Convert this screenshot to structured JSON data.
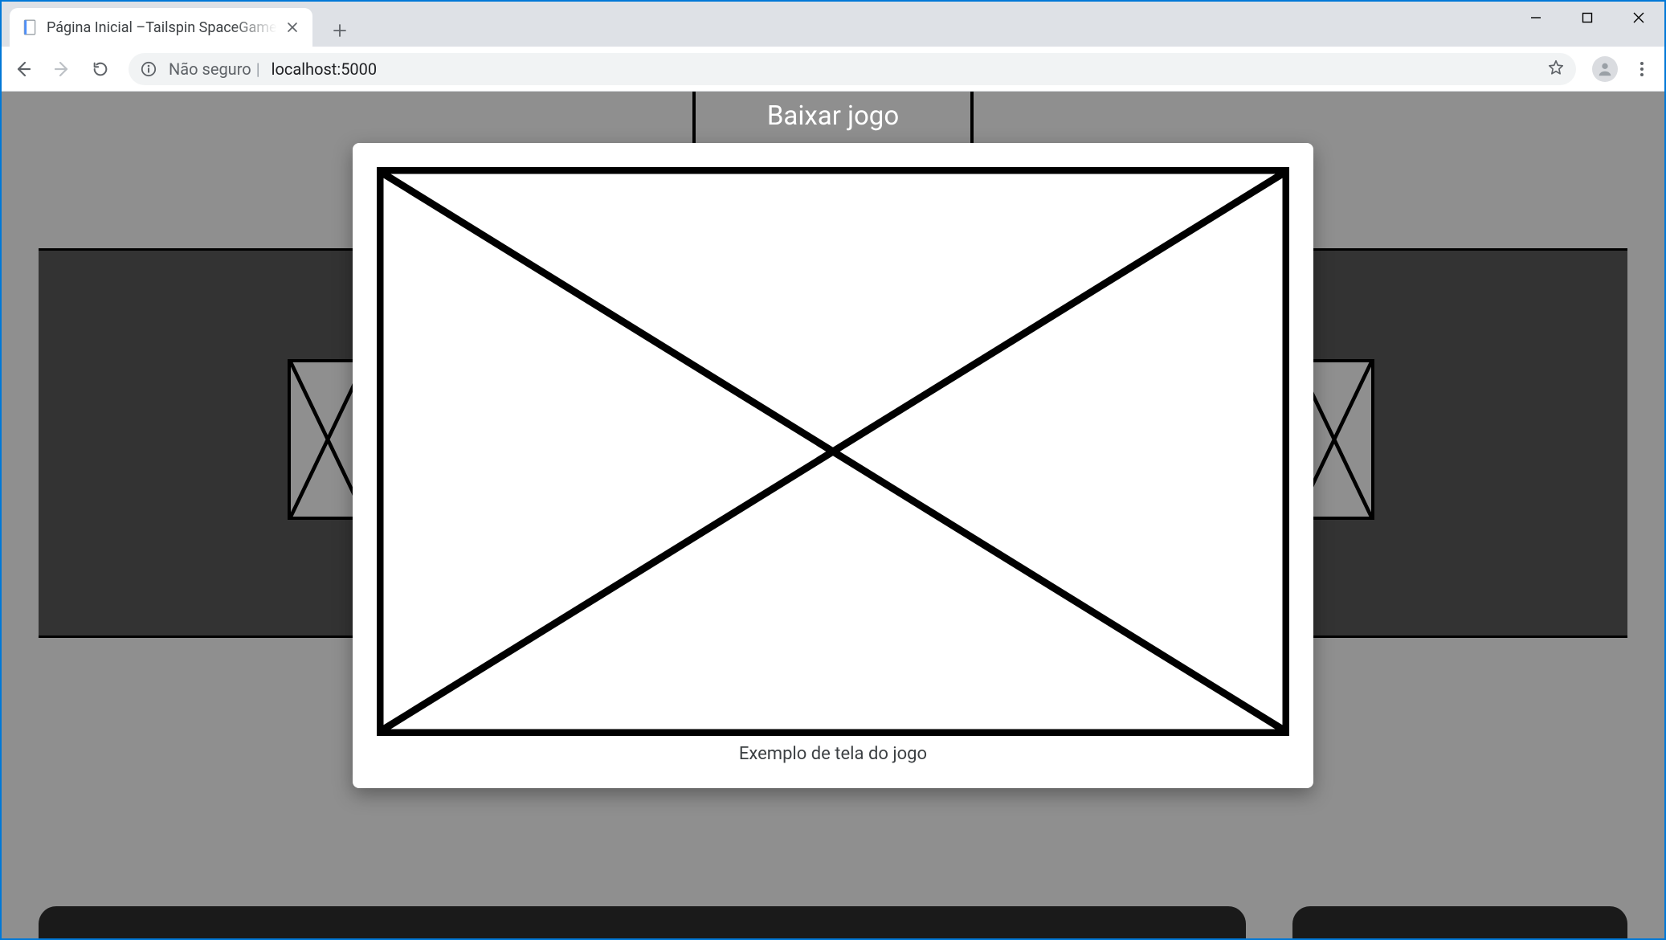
{
  "browser": {
    "tab_title": "Página Inicial –Tailspin SpaceGame",
    "security_label": "Não seguro",
    "url": "localhost:5000"
  },
  "page": {
    "download_button_label": "Baixar jogo"
  },
  "modal": {
    "caption": "Exemplo de tela do jogo"
  }
}
